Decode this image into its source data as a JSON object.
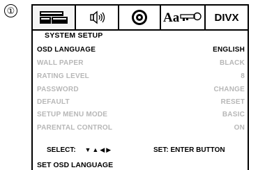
{
  "figure_number": "①",
  "tabs": [
    {
      "icon": "setup-screen-icon",
      "active": false
    },
    {
      "icon": "speaker-audio-icon",
      "active": false
    },
    {
      "icon": "disc-icon",
      "active": false
    },
    {
      "icon": "language-key-icon",
      "active": true,
      "label": "Aa"
    },
    {
      "icon": "divx-logo-icon",
      "active": false,
      "label": "DIVX"
    }
  ],
  "menu": {
    "title": "SYSTEM SETUP",
    "items": [
      {
        "label": "OSD LANGUAGE",
        "value": "ENGLISH",
        "state": "highlighted"
      },
      {
        "label": "WALL PAPER",
        "value": "BLACK",
        "state": "dimmed"
      },
      {
        "label": "RATING LEVEL",
        "value": "8",
        "state": "dimmed"
      },
      {
        "label": "PASSWORD",
        "value": "CHANGE",
        "state": "dimmed"
      },
      {
        "label": "DEFAULT",
        "value": "RESET",
        "state": "dimmed"
      },
      {
        "label": "SETUP MENU MODE",
        "value": "BASIC",
        "state": "dimmed"
      },
      {
        "label": "PARENTAL CONTROL",
        "value": "ON",
        "state": "dimmed"
      }
    ]
  },
  "footer": {
    "select_label": "SELECT:",
    "select_arrows": "▼▲◀▶",
    "set_label": "SET: ENTER BUTTON",
    "hint": "SET OSD LANGUAGE"
  }
}
